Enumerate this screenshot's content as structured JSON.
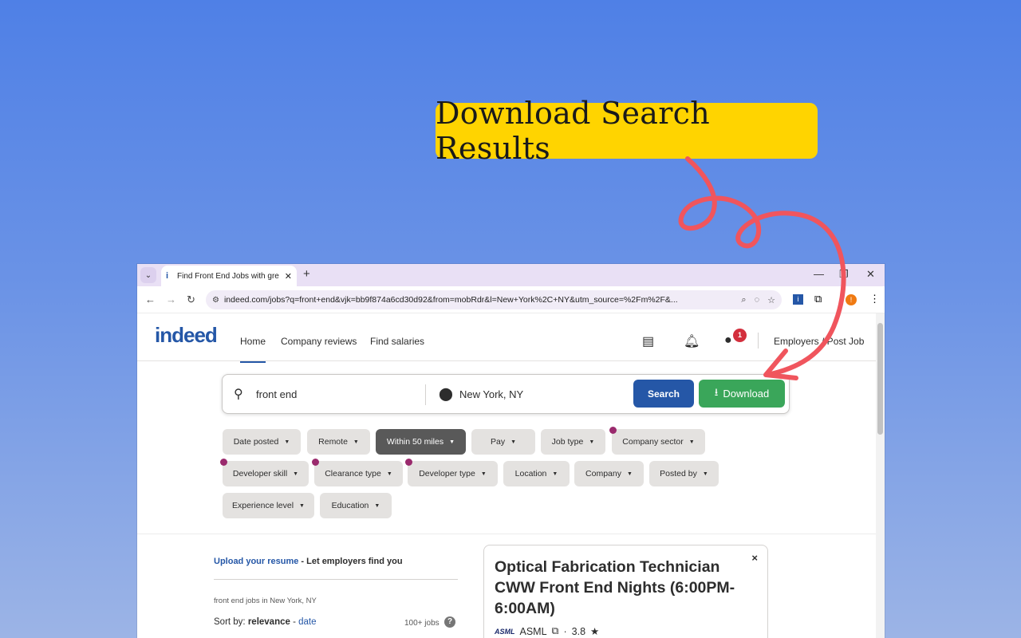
{
  "callout": {
    "text": "Download Search Results"
  },
  "browser": {
    "tab_title": "Find Front End Jobs with gre",
    "tab_favicon": "i",
    "new_tab": "+",
    "url": "indeed.com/jobs?q=front+end&vjk=bb9f874a6cd30d92&from=mobRdr&l=New+York%2C+NY&utm_source=%2Fm%2F&..."
  },
  "site": {
    "logo": "indeed",
    "nav": [
      "Home",
      "Company reviews",
      "Find salaries"
    ],
    "notification_count": "1",
    "employers_link": "Employers / Post Job"
  },
  "search": {
    "what": "front end",
    "where": "New York, NY",
    "search_button": "Search",
    "download_button": "Download"
  },
  "filters": [
    "Date posted",
    "Remote",
    "Within 50 miles",
    "Pay",
    "Job type",
    "Company sector",
    "Developer skill",
    "Clearance type",
    "Developer type",
    "Location",
    "Company",
    "Posted by",
    "Experience level",
    "Education"
  ],
  "results": {
    "upload_link": "Upload your resume",
    "upload_rest": " - Let employers find you",
    "breadcrumb": "front end jobs in New York, NY",
    "sort_label": "Sort by: ",
    "sort_active": "relevance",
    "sort_sep": " - ",
    "sort_other": "date",
    "count": "100+ jobs",
    "help": "?"
  },
  "job_card": {
    "title": "Optical Fabrication Technician CWW Front End Nights (6:00PM-6:00AM)",
    "company_logo": "ASML",
    "company": "ASML",
    "rating": "3.8",
    "close": "×"
  },
  "colors": {
    "accent_blue": "#2557a7",
    "download_green": "#3aa65a",
    "callout_yellow": "#ffd400",
    "arrow_red": "#f0555d"
  }
}
